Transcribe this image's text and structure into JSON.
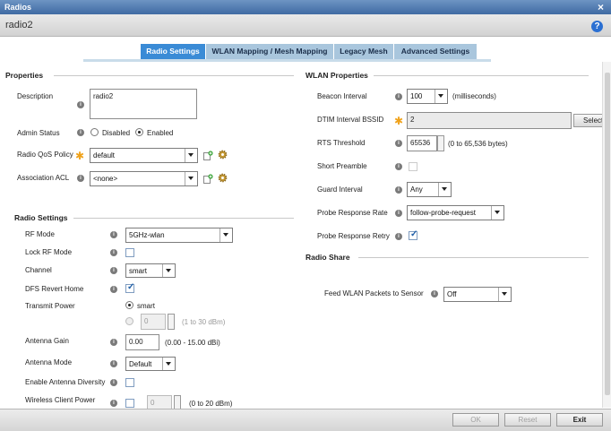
{
  "window": {
    "title": "Radios",
    "close": "×"
  },
  "header": {
    "name": "radio2",
    "help": "?"
  },
  "tabs": [
    {
      "label": "Radio Settings"
    },
    {
      "label": "WLAN Mapping / Mesh Mapping"
    },
    {
      "label": "Legacy Mesh"
    },
    {
      "label": "Advanced Settings"
    }
  ],
  "properties": {
    "title": "Properties",
    "description_label": "Description",
    "description_value": "radio2",
    "admin_status_label": "Admin Status",
    "disabled_label": "Disabled",
    "enabled_label": "Enabled",
    "qos_label": "Radio QoS Policy",
    "qos_value": "default",
    "acl_label": "Association ACL",
    "acl_value": "<none>"
  },
  "radio_settings": {
    "title": "Radio Settings",
    "rf_mode_label": "RF Mode",
    "rf_mode_value": "5GHz-wlan",
    "lock_rf_label": "Lock RF Mode",
    "channel_label": "Channel",
    "channel_value": "smart",
    "dfs_label": "DFS Revert Home",
    "tx_power_label": "Transmit Power",
    "tx_smart": "smart",
    "tx_value": "0",
    "tx_range": "(1 to 30 dBm)",
    "antenna_gain_label": "Antenna Gain",
    "antenna_gain_value": "0.00",
    "antenna_gain_range": "(0.00 - 15.00 dBi)",
    "antenna_mode_label": "Antenna Mode",
    "antenna_mode_value": "Default",
    "antenna_div_label": "Enable Antenna Diversity",
    "client_power_label": "Wireless Client Power",
    "client_power_value": "0",
    "client_power_range": "(0 to 20 dBm)"
  },
  "wlan_properties": {
    "title": "WLAN Properties",
    "beacon_label": "Beacon Interval",
    "beacon_value": "100",
    "beacon_unit": "(milliseconds)",
    "dtim_label": "DTIM Interval BSSID",
    "dtim_value": "2",
    "select_label": "Select",
    "rts_label": "RTS Threshold",
    "rts_value": "65536",
    "rts_range": "(0 to 65,536 bytes)",
    "preamble_label": "Short Preamble",
    "guard_label": "Guard Interval",
    "guard_value": "Any",
    "probe_rate_label": "Probe Response Rate",
    "probe_rate_value": "follow-probe-request",
    "probe_retry_label": "Probe Response Retry"
  },
  "radio_share": {
    "title": "Radio Share",
    "feed_label": "Feed WLAN Packets to Sensor",
    "feed_value": "Off"
  },
  "footer": {
    "ok": "OK",
    "reset": "Reset",
    "exit": "Exit"
  }
}
